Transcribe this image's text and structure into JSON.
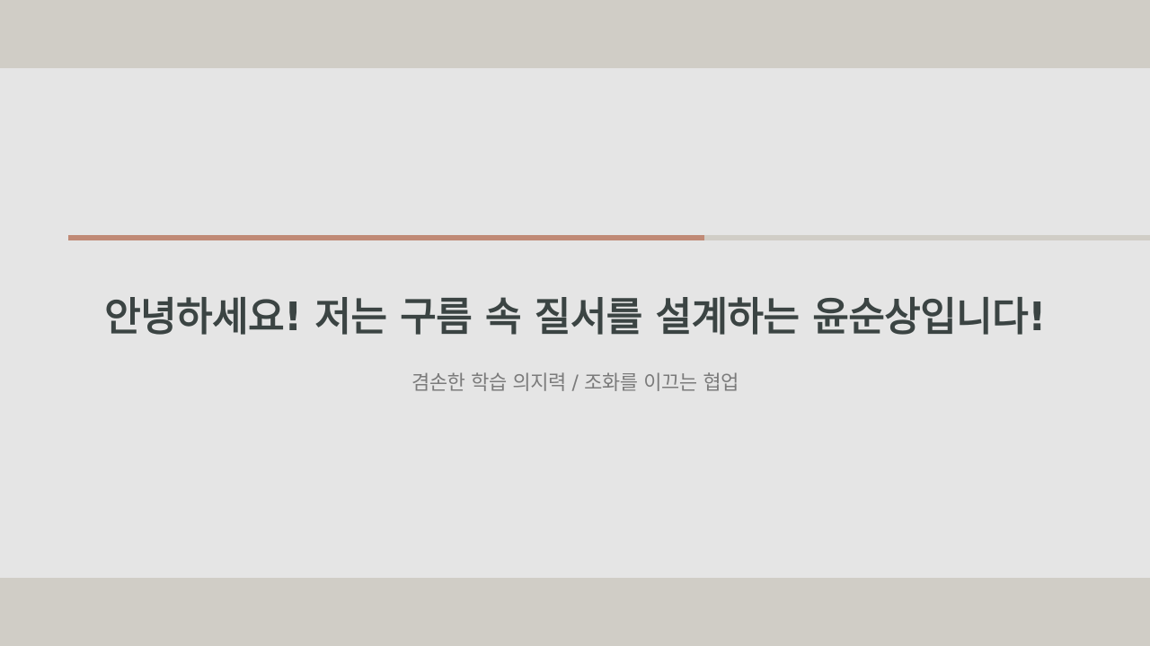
{
  "slide": {
    "title": "안녕하세요! 저는 구름 속 질서를 설계하는 윤순상입니다!",
    "subtitle": "겸손한 학습 의지력 / 조화를 이끄는 협업"
  },
  "colors": {
    "frame_band": "#d0cdc6",
    "slide_background": "#e5e5e5",
    "accent_rule": "#c08a76",
    "title_text": "#3b4443",
    "subtitle_text": "#7b7b7b"
  }
}
